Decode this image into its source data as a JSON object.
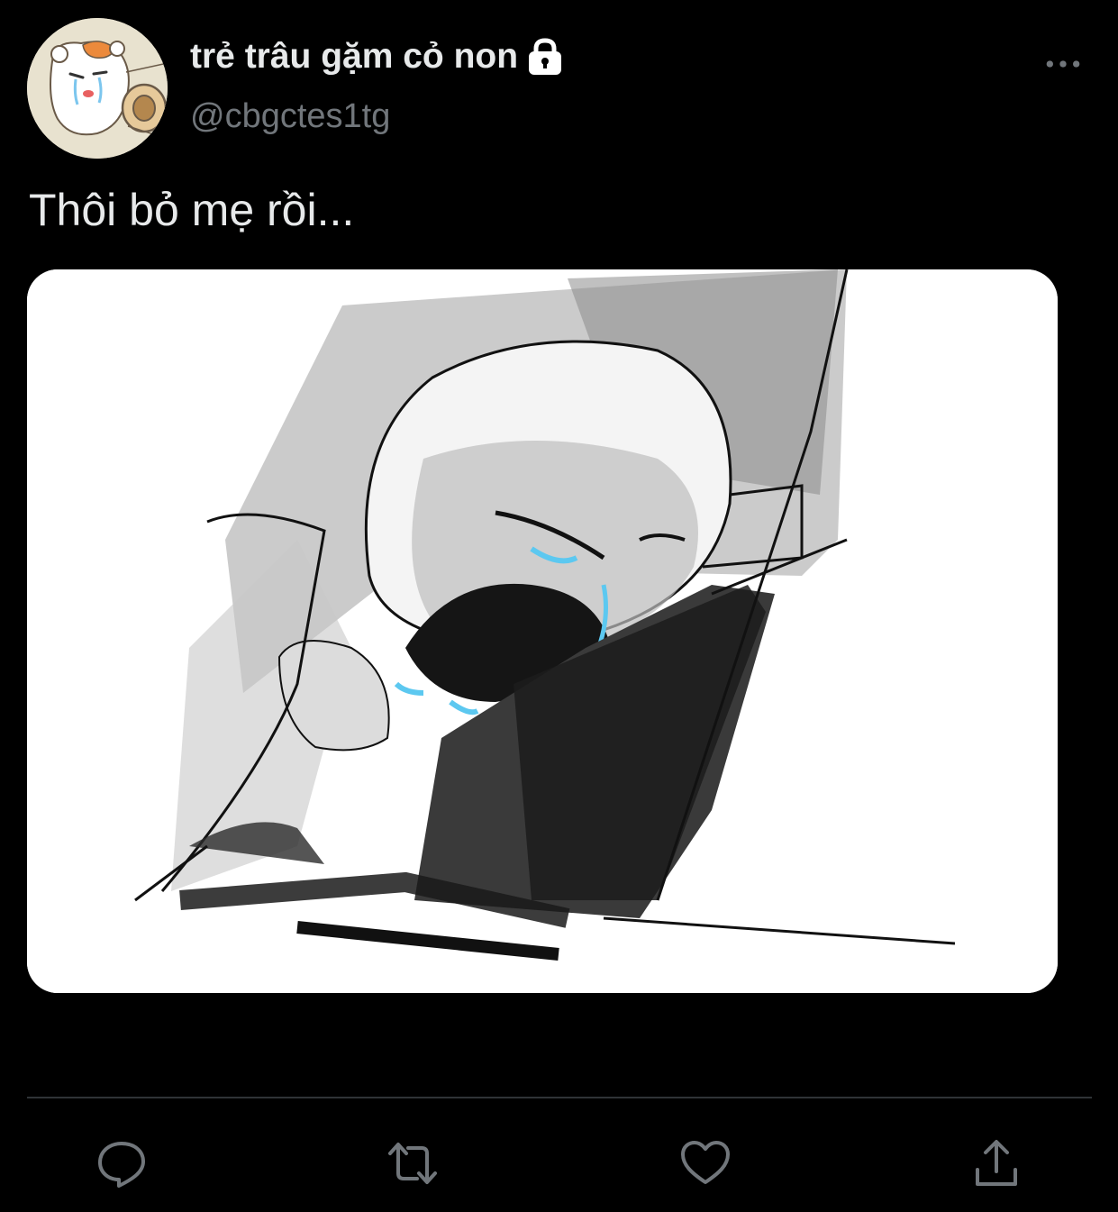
{
  "author": {
    "display_name": "trẻ trâu gặm cỏ non",
    "handle": "@cbgctes1tg",
    "protected": true,
    "avatar_icon": "hamster-crying-avatar"
  },
  "tweet": {
    "text": "Thôi bỏ mẹ rồi...",
    "media_icon": "crying-sketch-image"
  },
  "menu": {
    "more_icon": "more-horizontal-icon"
  },
  "actions": [
    {
      "name": "reply",
      "icon": "reply-icon"
    },
    {
      "name": "retweet",
      "icon": "retweet-icon"
    },
    {
      "name": "like",
      "icon": "heart-icon"
    },
    {
      "name": "share",
      "icon": "share-icon"
    }
  ],
  "colors": {
    "background": "#000000",
    "primary_text": "#e7e9ea",
    "secondary_text": "#71767b",
    "divider": "#2f3336",
    "tear_blue": "#5cc8f0"
  }
}
